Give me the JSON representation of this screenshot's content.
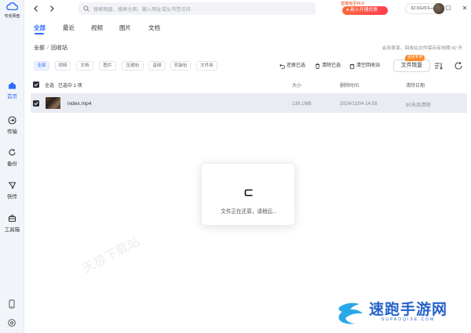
{
  "app": {
    "name": "夸克网盘"
  },
  "sidebar": {
    "items": [
      {
        "label": "首页",
        "icon": "home-icon"
      },
      {
        "label": "传输",
        "icon": "transfer-icon"
      },
      {
        "label": "备份",
        "icon": "backup-icon"
      },
      {
        "label": "快传",
        "icon": "quick-send-icon"
      },
      {
        "label": "工具箱",
        "icon": "toolbox-icon"
      }
    ],
    "bottom": [
      {
        "icon": "phone-icon"
      },
      {
        "icon": "settings-icon"
      }
    ]
  },
  "search": {
    "placeholder": "搜索网盘、搜索全网、输入网址或从书签访问"
  },
  "promo": {
    "small": "直降拖至¥9.8",
    "pill": "新人开通优惠"
  },
  "quota": "32.5G/6T",
  "window": {
    "min": "—",
    "max": "☐",
    "close": "✕"
  },
  "tabs": [
    "全部",
    "最近",
    "视频",
    "图片",
    "文档"
  ],
  "breadcrumb": {
    "root": "全部",
    "sep": "/",
    "current": "回收站"
  },
  "note": "会员尊享，回收站文件保存有效期 90 天",
  "filters": [
    "全部",
    "视频",
    "文档",
    "图片",
    "压缩包",
    "音频",
    "安装包",
    "文件夹"
  ],
  "actions": {
    "restore_selected": "还原已选",
    "clear_selected": "清除已选",
    "empty_bin": "清空回收站",
    "file_restore": "文件恢复",
    "vip_badge": "会员专享"
  },
  "table": {
    "select_all": "全选",
    "selected_count": "已选中 1 项",
    "headers": {
      "size": "大小",
      "deleted_time": "删除时间",
      "clear_date": "清除日期"
    },
    "rows": [
      {
        "name": "index.mp4",
        "size": "139.1MB",
        "deleted_time": "2024/11/04 14:58",
        "clear_date": "90天后清除"
      }
    ]
  },
  "dialog": {
    "message": "文件正在还原，请稍后..."
  },
  "watermark": {
    "left": "天极下载站",
    "brand": "速跑手游网",
    "brand_en": "SUPAOQISE.COM"
  },
  "colors": {
    "accent": "#2f6bff",
    "promo": "#ff4d3d"
  }
}
